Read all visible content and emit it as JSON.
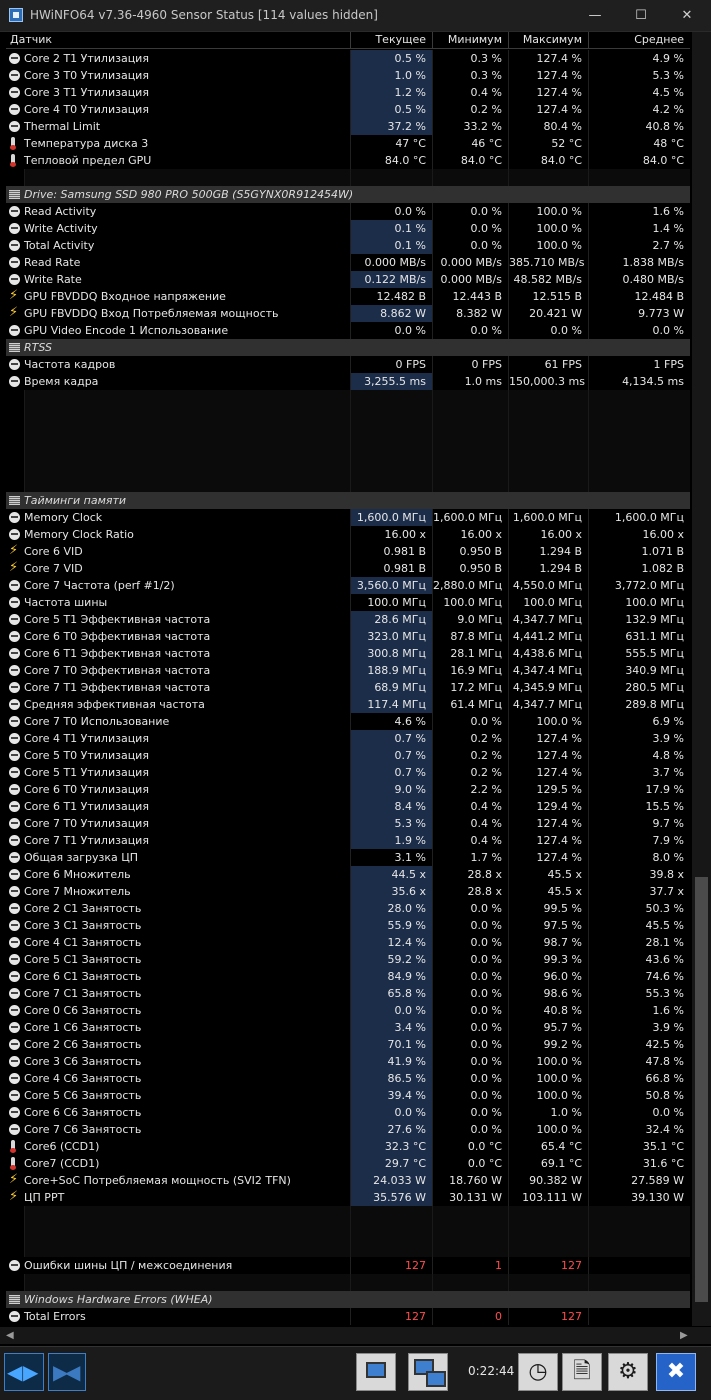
{
  "window": {
    "title": "HWiNFO64 v7.36-4960 Sensor Status [114 values hidden]"
  },
  "columns": [
    "Датчик",
    "Текущее",
    "Минимум",
    "Максимум",
    "Среднее"
  ],
  "rows": [
    {
      "type": "data",
      "icon": "gauge",
      "name": "Core 2 T1 Утилизация",
      "v": [
        "0.5 %",
        "0.3 %",
        "127.4 %",
        "4.9 %"
      ],
      "hl": true
    },
    {
      "type": "data",
      "icon": "gauge",
      "name": "Core 3 T0 Утилизация",
      "v": [
        "1.0 %",
        "0.3 %",
        "127.4 %",
        "5.3 %"
      ],
      "hl": true
    },
    {
      "type": "data",
      "icon": "gauge",
      "name": "Core 3 T1 Утилизация",
      "v": [
        "1.2 %",
        "0.4 %",
        "127.4 %",
        "4.5 %"
      ],
      "hl": true
    },
    {
      "type": "data",
      "icon": "gauge",
      "name": "Core 4 T0 Утилизация",
      "v": [
        "0.5 %",
        "0.2 %",
        "127.4 %",
        "4.2 %"
      ],
      "hl": true
    },
    {
      "type": "data",
      "icon": "gauge",
      "name": "Thermal Limit",
      "v": [
        "37.2 %",
        "33.2 %",
        "80.4 %",
        "40.8 %"
      ],
      "hl": true
    },
    {
      "type": "data",
      "icon": "thermo",
      "name": "Температура диска 3",
      "v": [
        "47 °C",
        "46 °C",
        "52 °C",
        "48 °C"
      ]
    },
    {
      "type": "data",
      "icon": "thermo",
      "name": "Тепловой предел GPU",
      "v": [
        "84.0 °C",
        "84.0 °C",
        "84.0 °C",
        "84.0 °C"
      ]
    },
    {
      "type": "blank"
    },
    {
      "type": "section",
      "icon": "drive",
      "name": "Drive: Samsung SSD 980 PRO 500GB (S5GYNX0R912454W)"
    },
    {
      "type": "data",
      "icon": "gauge",
      "name": "Read Activity",
      "v": [
        "0.0 %",
        "0.0 %",
        "100.0 %",
        "1.6 %"
      ]
    },
    {
      "type": "data",
      "icon": "gauge",
      "name": "Write Activity",
      "v": [
        "0.1 %",
        "0.0 %",
        "100.0 %",
        "1.4 %"
      ],
      "hl": true
    },
    {
      "type": "data",
      "icon": "gauge",
      "name": "Total Activity",
      "v": [
        "0.1 %",
        "0.0 %",
        "100.0 %",
        "2.7 %"
      ],
      "hl": true
    },
    {
      "type": "data",
      "icon": "gauge",
      "name": "Read Rate",
      "v": [
        "0.000 MB/s",
        "0.000 MB/s",
        "385.710 MB/s",
        "1.838 MB/s"
      ]
    },
    {
      "type": "data",
      "icon": "gauge",
      "name": "Write Rate",
      "v": [
        "0.122 MB/s",
        "0.000 MB/s",
        "48.582 MB/s",
        "0.480 MB/s"
      ],
      "hl": true
    },
    {
      "type": "data",
      "icon": "bolt",
      "name": "GPU FBVDDQ Входное напряжение",
      "v": [
        "12.482 В",
        "12.443 В",
        "12.515 В",
        "12.484 В"
      ]
    },
    {
      "type": "data",
      "icon": "bolt",
      "name": "GPU FBVDDQ Вход Потребляемая мощность",
      "v": [
        "8.862 W",
        "8.382 W",
        "20.421 W",
        "9.773 W"
      ],
      "hl": true
    },
    {
      "type": "data",
      "icon": "gauge",
      "name": "GPU Video Encode 1 Использование",
      "v": [
        "0.0 %",
        "0.0 %",
        "0.0 %",
        "0.0 %"
      ]
    },
    {
      "type": "section",
      "icon": "drive",
      "name": "RTSS"
    },
    {
      "type": "data",
      "icon": "gauge",
      "name": "Частота кадров",
      "v": [
        "0 FPS",
        "0 FPS",
        "61 FPS",
        "1 FPS"
      ]
    },
    {
      "type": "data",
      "icon": "gauge",
      "name": "Время кадра",
      "v": [
        "3,255.5 ms",
        "1.0 ms",
        "150,000.3 ms",
        "4,134.5 ms"
      ],
      "hl": true
    },
    {
      "type": "blank"
    },
    {
      "type": "blank"
    },
    {
      "type": "blank"
    },
    {
      "type": "blank"
    },
    {
      "type": "blank"
    },
    {
      "type": "blank"
    },
    {
      "type": "section",
      "icon": "drive",
      "name": "Тайминги памяти"
    },
    {
      "type": "data",
      "icon": "gauge",
      "name": "Memory Clock",
      "v": [
        "1,600.0 MГц",
        "1,600.0 MГц",
        "1,600.0 MГц",
        "1,600.0 MГц"
      ],
      "hl": true
    },
    {
      "type": "data",
      "icon": "gauge",
      "name": "Memory Clock Ratio",
      "v": [
        "16.00 x",
        "16.00 x",
        "16.00 x",
        "16.00 x"
      ]
    },
    {
      "type": "data",
      "icon": "bolt",
      "name": "Core 6 VID",
      "v": [
        "0.981 В",
        "0.950 В",
        "1.294 В",
        "1.071 В"
      ]
    },
    {
      "type": "data",
      "icon": "bolt",
      "name": "Core 7 VID",
      "v": [
        "0.981 В",
        "0.950 В",
        "1.294 В",
        "1.082 В"
      ]
    },
    {
      "type": "data",
      "icon": "gauge",
      "name": "Core 7 Частота (perf #1/2)",
      "v": [
        "3,560.0 MГц",
        "2,880.0 MГц",
        "4,550.0 MГц",
        "3,772.0 MГц"
      ],
      "hl": true
    },
    {
      "type": "data",
      "icon": "gauge",
      "name": "Частота шины",
      "v": [
        "100.0 MГц",
        "100.0 MГц",
        "100.0 MГц",
        "100.0 MГц"
      ]
    },
    {
      "type": "data",
      "icon": "gauge",
      "name": "Core 5 T1 Эффективная частота",
      "v": [
        "28.6 MГц",
        "9.0 MГц",
        "4,347.7 MГц",
        "132.9 MГц"
      ],
      "hl": true
    },
    {
      "type": "data",
      "icon": "gauge",
      "name": "Core 6 T0 Эффективная частота",
      "v": [
        "323.0 MГц",
        "87.8 MГц",
        "4,441.2 MГц",
        "631.1 MГц"
      ],
      "hl": true
    },
    {
      "type": "data",
      "icon": "gauge",
      "name": "Core 6 T1 Эффективная частота",
      "v": [
        "300.8 MГц",
        "28.1 MГц",
        "4,438.6 MГц",
        "555.5 MГц"
      ],
      "hl": true
    },
    {
      "type": "data",
      "icon": "gauge",
      "name": "Core 7 T0 Эффективная частота",
      "v": [
        "188.9 MГц",
        "16.9 MГц",
        "4,347.4 MГц",
        "340.9 MГц"
      ],
      "hl": true
    },
    {
      "type": "data",
      "icon": "gauge",
      "name": "Core 7 T1 Эффективная частота",
      "v": [
        "68.9 MГц",
        "17.2 MГц",
        "4,345.9 MГц",
        "280.5 MГц"
      ],
      "hl": true
    },
    {
      "type": "data",
      "icon": "gauge",
      "name": "Средняя эффективная частота",
      "v": [
        "117.4 MГц",
        "61.4 MГц",
        "4,347.7 MГц",
        "289.8 MГц"
      ],
      "hl": true
    },
    {
      "type": "data",
      "icon": "gauge",
      "name": "Core 7 T0 Использование",
      "v": [
        "4.6 %",
        "0.0 %",
        "100.0 %",
        "6.9 %"
      ]
    },
    {
      "type": "data",
      "icon": "gauge",
      "name": "Core 4 T1 Утилизация",
      "v": [
        "0.7 %",
        "0.2 %",
        "127.4 %",
        "3.9 %"
      ],
      "hl": true
    },
    {
      "type": "data",
      "icon": "gauge",
      "name": "Core 5 T0 Утилизация",
      "v": [
        "0.7 %",
        "0.2 %",
        "127.4 %",
        "4.8 %"
      ],
      "hl": true
    },
    {
      "type": "data",
      "icon": "gauge",
      "name": "Core 5 T1 Утилизация",
      "v": [
        "0.7 %",
        "0.2 %",
        "127.4 %",
        "3.7 %"
      ],
      "hl": true
    },
    {
      "type": "data",
      "icon": "gauge",
      "name": "Core 6 T0 Утилизация",
      "v": [
        "9.0 %",
        "2.2 %",
        "129.5 %",
        "17.9 %"
      ],
      "hl": true
    },
    {
      "type": "data",
      "icon": "gauge",
      "name": "Core 6 T1 Утилизация",
      "v": [
        "8.4 %",
        "0.4 %",
        "129.4 %",
        "15.5 %"
      ],
      "hl": true
    },
    {
      "type": "data",
      "icon": "gauge",
      "name": "Core 7 T0 Утилизация",
      "v": [
        "5.3 %",
        "0.4 %",
        "127.4 %",
        "9.7 %"
      ],
      "hl": true
    },
    {
      "type": "data",
      "icon": "gauge",
      "name": "Core 7 T1 Утилизация",
      "v": [
        "1.9 %",
        "0.4 %",
        "127.4 %",
        "7.9 %"
      ],
      "hl": true
    },
    {
      "type": "data",
      "icon": "gauge",
      "name": "Общая загрузка ЦП",
      "v": [
        "3.1 %",
        "1.7 %",
        "127.4 %",
        "8.0 %"
      ]
    },
    {
      "type": "data",
      "icon": "gauge",
      "name": "Core 6 Множитель",
      "v": [
        "44.5 x",
        "28.8 x",
        "45.5 x",
        "39.8 x"
      ],
      "hl": true
    },
    {
      "type": "data",
      "icon": "gauge",
      "name": "Core 7 Множитель",
      "v": [
        "35.6 x",
        "28.8 x",
        "45.5 x",
        "37.7 x"
      ],
      "hl": true
    },
    {
      "type": "data",
      "icon": "gauge",
      "name": "Core 2 C1 Занятость",
      "v": [
        "28.0 %",
        "0.0 %",
        "99.5 %",
        "50.3 %"
      ],
      "hl": true
    },
    {
      "type": "data",
      "icon": "gauge",
      "name": "Core 3 C1 Занятость",
      "v": [
        "55.9 %",
        "0.0 %",
        "97.5 %",
        "45.5 %"
      ],
      "hl": true
    },
    {
      "type": "data",
      "icon": "gauge",
      "name": "Core 4 C1 Занятость",
      "v": [
        "12.4 %",
        "0.0 %",
        "98.7 %",
        "28.1 %"
      ],
      "hl": true
    },
    {
      "type": "data",
      "icon": "gauge",
      "name": "Core 5 C1 Занятость",
      "v": [
        "59.2 %",
        "0.0 %",
        "99.3 %",
        "43.6 %"
      ],
      "hl": true
    },
    {
      "type": "data",
      "icon": "gauge",
      "name": "Core 6 C1 Занятость",
      "v": [
        "84.9 %",
        "0.0 %",
        "96.0 %",
        "74.6 %"
      ],
      "hl": true
    },
    {
      "type": "data",
      "icon": "gauge",
      "name": "Core 7 C1 Занятость",
      "v": [
        "65.8 %",
        "0.0 %",
        "98.6 %",
        "55.3 %"
      ],
      "hl": true
    },
    {
      "type": "data",
      "icon": "gauge",
      "name": "Core 0 C6 Занятость",
      "v": [
        "0.0 %",
        "0.0 %",
        "40.8 %",
        "1.6 %"
      ],
      "hl": true
    },
    {
      "type": "data",
      "icon": "gauge",
      "name": "Core 1 C6 Занятость",
      "v": [
        "3.4 %",
        "0.0 %",
        "95.7 %",
        "3.9 %"
      ],
      "hl": true
    },
    {
      "type": "data",
      "icon": "gauge",
      "name": "Core 2 C6 Занятость",
      "v": [
        "70.1 %",
        "0.0 %",
        "99.2 %",
        "42.5 %"
      ],
      "hl": true
    },
    {
      "type": "data",
      "icon": "gauge",
      "name": "Core 3 C6 Занятость",
      "v": [
        "41.9 %",
        "0.0 %",
        "100.0 %",
        "47.8 %"
      ],
      "hl": true
    },
    {
      "type": "data",
      "icon": "gauge",
      "name": "Core 4 C6 Занятость",
      "v": [
        "86.5 %",
        "0.0 %",
        "100.0 %",
        "66.8 %"
      ],
      "hl": true
    },
    {
      "type": "data",
      "icon": "gauge",
      "name": "Core 5 C6 Занятость",
      "v": [
        "39.4 %",
        "0.0 %",
        "100.0 %",
        "50.8 %"
      ],
      "hl": true
    },
    {
      "type": "data",
      "icon": "gauge",
      "name": "Core 6 C6 Занятость",
      "v": [
        "0.0 %",
        "0.0 %",
        "1.0 %",
        "0.0 %"
      ],
      "hl": true
    },
    {
      "type": "data",
      "icon": "gauge",
      "name": "Core 7 C6 Занятость",
      "v": [
        "27.6 %",
        "0.0 %",
        "100.0 %",
        "32.4 %"
      ],
      "hl": true
    },
    {
      "type": "data",
      "icon": "thermo",
      "name": "Core6 (CCD1)",
      "v": [
        "32.3 °C",
        "0.0 °C",
        "65.4 °C",
        "35.1 °C"
      ],
      "hl": true
    },
    {
      "type": "data",
      "icon": "thermo",
      "name": "Core7 (CCD1)",
      "v": [
        "29.7 °C",
        "0.0 °C",
        "69.1 °C",
        "31.6 °C"
      ],
      "hl": true
    },
    {
      "type": "data",
      "icon": "bolt",
      "name": "Core+SoC Потребляемая мощность (SVI2 TFN)",
      "v": [
        "24.033 W",
        "18.760 W",
        "90.382 W",
        "27.589 W"
      ],
      "hl": true
    },
    {
      "type": "data",
      "icon": "bolt",
      "name": "ЦП PPT",
      "v": [
        "35.576 W",
        "30.131 W",
        "103.111 W",
        "39.130 W"
      ],
      "hl": true
    },
    {
      "type": "blank"
    },
    {
      "type": "blank"
    },
    {
      "type": "blank"
    },
    {
      "type": "data",
      "icon": "gauge",
      "name": "Ошибки шины ЦП / межсоединения",
      "v": [
        "127",
        "1",
        "127",
        ""
      ],
      "err": true
    },
    {
      "type": "blank"
    },
    {
      "type": "section",
      "icon": "drive",
      "name": "Windows Hardware Errors (WHEA)"
    },
    {
      "type": "data",
      "icon": "gauge",
      "name": "Total Errors",
      "v": [
        "127",
        "0",
        "127",
        ""
      ],
      "err": true
    }
  ],
  "toolbar": {
    "timer": "0:22:44"
  }
}
